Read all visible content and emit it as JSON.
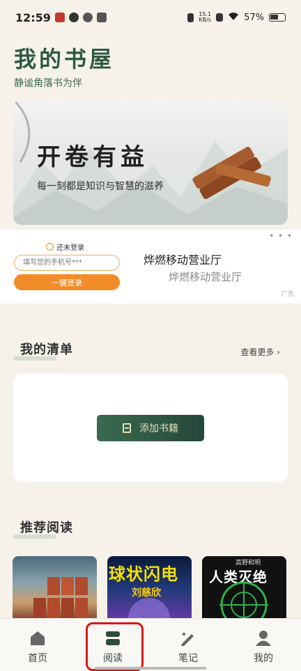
{
  "status_bar": {
    "time": "12:59",
    "net_speed_value": "15.1",
    "net_speed_unit": "KB/s",
    "battery": "57%"
  },
  "header": {
    "title": "我的书屋",
    "subtitle": "静谧角落书为伴"
  },
  "banner": {
    "title": "开卷有益",
    "subtitle": "每一刻都是知识与智慧的滋养"
  },
  "ad": {
    "login_status": "还未登录",
    "phone_placeholder": "填写您的手机号***",
    "login_button": "一键登录",
    "company_name": "烨燃移动营业厅",
    "company_name_sub": "烨燃移动营业厅",
    "ad_label": "广告",
    "more_dots": "• • •"
  },
  "my_list": {
    "title": "我的清单",
    "see_more": "查看更多 ›",
    "add_button": "添加书籍"
  },
  "recommended": {
    "title": "推荐阅读",
    "books": [
      {
        "cover_color": "#7a3325"
      },
      {
        "title": "球状闪电",
        "author": "刘慈欣",
        "cover_color": "#223a7a"
      },
      {
        "title": "人类灭绝",
        "author": "高野和明",
        "cover_color": "#111111"
      }
    ]
  },
  "tabbar": {
    "items": [
      {
        "label": "首页",
        "icon": "home-icon"
      },
      {
        "label": "阅读",
        "icon": "reading-icon",
        "active": true
      },
      {
        "label": "笔记",
        "icon": "pen-icon"
      },
      {
        "label": "我的",
        "icon": "user-icon"
      }
    ]
  },
  "colors": {
    "accent": "#2f5a42",
    "highlight": "#d11a1a",
    "login_orange": "#f28c28"
  }
}
